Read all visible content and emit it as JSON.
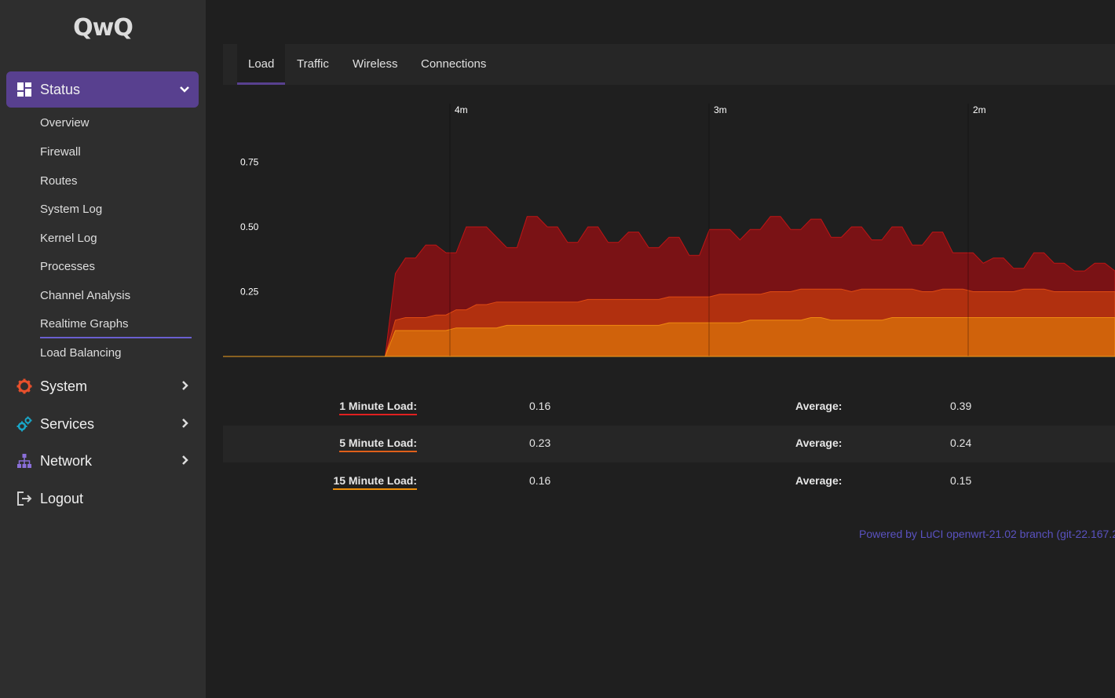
{
  "brand": {
    "logo_text": "QwQ"
  },
  "sidebar": {
    "status": {
      "label": "Status",
      "items": [
        {
          "label": "Overview"
        },
        {
          "label": "Firewall"
        },
        {
          "label": "Routes"
        },
        {
          "label": "System Log"
        },
        {
          "label": "Kernel Log"
        },
        {
          "label": "Processes"
        },
        {
          "label": "Channel Analysis"
        },
        {
          "label": "Realtime Graphs"
        },
        {
          "label": "Load Balancing"
        }
      ]
    },
    "system": {
      "label": "System"
    },
    "services": {
      "label": "Services"
    },
    "network": {
      "label": "Network"
    },
    "logout": {
      "label": "Logout"
    }
  },
  "tabs": [
    {
      "label": "Load",
      "active": true
    },
    {
      "label": "Traffic"
    },
    {
      "label": "Wireless"
    },
    {
      "label": "Connections"
    }
  ],
  "chart_data": {
    "type": "area",
    "x_tick_labels": [
      "4m",
      "3m",
      "2m"
    ],
    "y_tick_labels": [
      "0.75",
      "0.50",
      "0.25"
    ],
    "ylim": [
      0,
      0.89
    ],
    "series": [
      {
        "name": "1 Minute Load",
        "color": "#7a1215",
        "values": [
          0,
          0,
          0,
          0,
          0,
          0,
          0,
          0,
          0,
          0,
          0,
          0,
          0,
          0,
          0,
          0,
          0,
          0.32,
          0.38,
          0.38,
          0.43,
          0.43,
          0.4,
          0.4,
          0.5,
          0.5,
          0.5,
          0.46,
          0.42,
          0.42,
          0.54,
          0.54,
          0.5,
          0.5,
          0.44,
          0.44,
          0.5,
          0.5,
          0.44,
          0.44,
          0.48,
          0.48,
          0.42,
          0.42,
          0.46,
          0.46,
          0.39,
          0.39,
          0.49,
          0.49,
          0.49,
          0.45,
          0.49,
          0.49,
          0.54,
          0.54,
          0.49,
          0.49,
          0.53,
          0.53,
          0.46,
          0.46,
          0.5,
          0.5,
          0.45,
          0.45,
          0.5,
          0.5,
          0.43,
          0.43,
          0.48,
          0.48,
          0.4,
          0.4,
          0.4,
          0.36,
          0.38,
          0.38,
          0.34,
          0.34,
          0.4,
          0.4,
          0.36,
          0.36,
          0.33,
          0.33,
          0.36,
          0.36,
          0.33
        ]
      },
      {
        "name": "5 Minute Load",
        "color": "#b1300f",
        "values": [
          0,
          0,
          0,
          0,
          0,
          0,
          0,
          0,
          0,
          0,
          0,
          0,
          0,
          0,
          0,
          0,
          0,
          0.14,
          0.15,
          0.15,
          0.15,
          0.16,
          0.16,
          0.18,
          0.18,
          0.2,
          0.2,
          0.21,
          0.21,
          0.21,
          0.21,
          0.21,
          0.21,
          0.21,
          0.21,
          0.21,
          0.22,
          0.22,
          0.22,
          0.22,
          0.22,
          0.22,
          0.22,
          0.22,
          0.23,
          0.23,
          0.23,
          0.23,
          0.23,
          0.24,
          0.24,
          0.24,
          0.24,
          0.24,
          0.25,
          0.25,
          0.25,
          0.26,
          0.26,
          0.26,
          0.26,
          0.26,
          0.25,
          0.26,
          0.26,
          0.26,
          0.26,
          0.26,
          0.26,
          0.25,
          0.25,
          0.26,
          0.26,
          0.26,
          0.25,
          0.25,
          0.25,
          0.25,
          0.25,
          0.26,
          0.26,
          0.26,
          0.25,
          0.25,
          0.25,
          0.25,
          0.25,
          0.25,
          0.25
        ]
      },
      {
        "name": "15 Minute Load",
        "color": "#d0620b",
        "values": [
          0,
          0,
          0,
          0,
          0,
          0,
          0,
          0,
          0,
          0,
          0,
          0,
          0,
          0,
          0,
          0,
          0,
          0.1,
          0.1,
          0.1,
          0.1,
          0.1,
          0.1,
          0.11,
          0.11,
          0.11,
          0.11,
          0.11,
          0.12,
          0.12,
          0.12,
          0.12,
          0.12,
          0.12,
          0.12,
          0.12,
          0.12,
          0.12,
          0.12,
          0.12,
          0.12,
          0.12,
          0.12,
          0.12,
          0.13,
          0.13,
          0.13,
          0.13,
          0.13,
          0.13,
          0.13,
          0.13,
          0.14,
          0.14,
          0.14,
          0.14,
          0.14,
          0.14,
          0.15,
          0.15,
          0.14,
          0.14,
          0.14,
          0.14,
          0.14,
          0.14,
          0.15,
          0.15,
          0.15,
          0.15,
          0.15,
          0.15,
          0.15,
          0.15,
          0.15,
          0.15,
          0.15,
          0.15,
          0.15,
          0.15,
          0.15,
          0.15,
          0.15,
          0.15,
          0.15,
          0.15,
          0.15,
          0.15,
          0.15
        ]
      }
    ]
  },
  "stats": [
    {
      "label": "1 Minute Load:",
      "value": "0.16",
      "avg_label": "Average:",
      "avg_value": "0.39",
      "color": "#e02020"
    },
    {
      "label": "5 Minute Load:",
      "value": "0.23",
      "avg_label": "Average:",
      "avg_value": "0.24",
      "color": "#e0601a"
    },
    {
      "label": "15 Minute Load:",
      "value": "0.16",
      "avg_label": "Average:",
      "avg_value": "0.15",
      "color": "#f0900a"
    }
  ],
  "footer": {
    "text": "Powered by LuCI openwrt-21.02 branch (git-22.167.2"
  }
}
